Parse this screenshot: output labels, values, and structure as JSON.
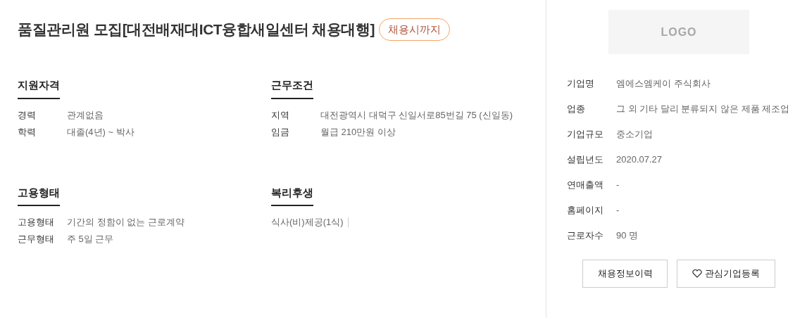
{
  "title": "품질관리원 모집[대전배재대ICT융합새일센터 채용대행]",
  "deadline_badge": "채용시까지",
  "sections": [
    {
      "heading": "지원자격",
      "rows": [
        {
          "label": "경력",
          "value": "관계없음"
        },
        {
          "label": "학력",
          "value": "대졸(4년) ~ 박사"
        }
      ]
    },
    {
      "heading": "근무조건",
      "rows": [
        {
          "label": "지역",
          "value": "대전광역시 대덕구 신일서로85번길 75 (신일동)"
        },
        {
          "label": "임금",
          "value": "월급 210만원 이상"
        }
      ]
    },
    {
      "heading": "고용형태",
      "rows": [
        {
          "label": "고용형태",
          "value": "기간의 정함이 없는 근로계약"
        },
        {
          "label": "근무형태",
          "value": "주 5일 근무"
        }
      ]
    },
    {
      "heading": "복리후생",
      "tags": [
        "식사(비)제공(1식)"
      ]
    }
  ],
  "company": {
    "logo_text": "LOGO",
    "rows": [
      {
        "label": "기업명",
        "value": "엠에스엠케이 주식회사"
      },
      {
        "label": "업종",
        "value": "그 외 기타 달리 분류되지 않은 제품 제조업"
      },
      {
        "label": "기업규모",
        "value": "중소기업"
      },
      {
        "label": "설립년도",
        "value": "2020.07.27"
      },
      {
        "label": "연매출액",
        "value": "-"
      },
      {
        "label": "홈페이지",
        "value": "-"
      },
      {
        "label": "근로자수",
        "value": "90 명"
      }
    ]
  },
  "buttons": [
    {
      "label": "채용정보이력",
      "kind": "plain"
    },
    {
      "label": "관심기업등록",
      "kind": "favorite"
    }
  ]
}
